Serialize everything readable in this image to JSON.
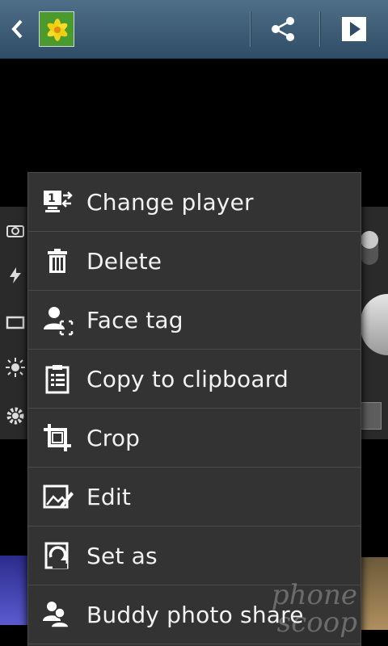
{
  "actionbar": {
    "back_icon": "back-chevron-icon",
    "share_icon": "share-icon",
    "play_icon": "play-icon"
  },
  "menu": {
    "items": [
      {
        "label": "Change player",
        "icon": "change-player-icon"
      },
      {
        "label": "Delete",
        "icon": "trash-icon"
      },
      {
        "label": "Face tag",
        "icon": "face-tag-icon"
      },
      {
        "label": "Copy to clipboard",
        "icon": "clipboard-icon"
      },
      {
        "label": "Crop",
        "icon": "crop-icon"
      },
      {
        "label": "Edit",
        "icon": "edit-photo-icon"
      },
      {
        "label": "Set as",
        "icon": "set-as-icon"
      },
      {
        "label": "Buddy photo share",
        "icon": "buddy-share-icon"
      }
    ]
  },
  "watermark": {
    "line1": "phone",
    "line2": "scoop"
  },
  "colors": {
    "actionbar": "#3e5d77",
    "menu_bg": "#333333",
    "menu_divider": "#4b4b4b",
    "menu_text": "#f2f2f2"
  }
}
